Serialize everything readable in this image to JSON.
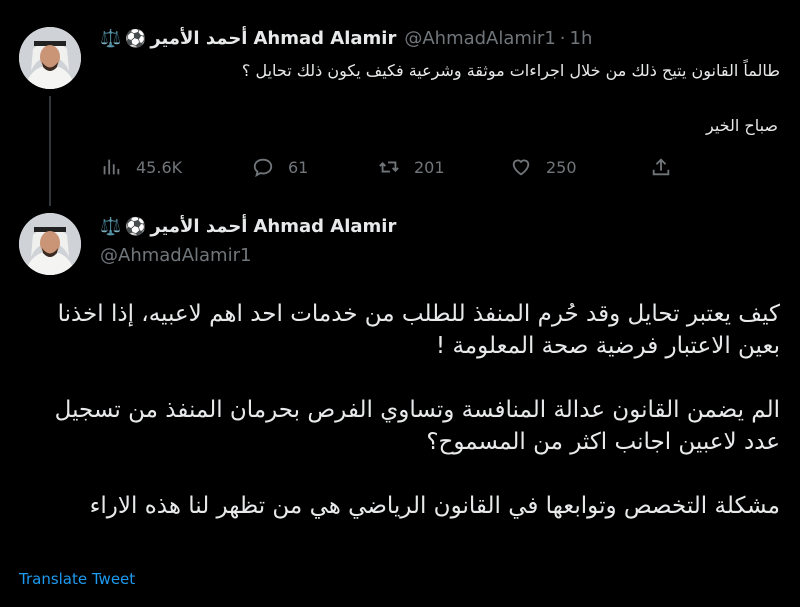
{
  "tweet1": {
    "display_name": "Ahmad Alamir",
    "arabic_name": "أحمد الأمير",
    "emoji_ball": "⚽",
    "emoji_scale": "⚖️",
    "handle": "@AhmadAlamir1",
    "separator": "·",
    "time": "1h",
    "text_line1": "طالماً القانون يتيح ذلك من خلال اجراءات موثقة وشرعية فكيف يكون ذلك تحايل ؟",
    "text_line2": "صباح الخير",
    "stats": {
      "views": "45.6K",
      "replies": "61",
      "retweets": "201",
      "likes": "250"
    }
  },
  "tweet2": {
    "display_name": "Ahmad Alamir",
    "arabic_name": "أحمد الأمير",
    "emoji_ball": "⚽",
    "emoji_scale": "⚖️",
    "handle": "@AhmadAlamir1",
    "para1_line1": "كيف يعتبر تحايل وقد حُرم المنفذ للطلب من خدمات احد اهم لاعبيه، إذا اخذنا",
    "para1_line2": "بعين الاعتبار فرضية صحة المعلومة !",
    "para2_line1": "الم يضمن القانون عدالة المنافسة وتساوي الفرص بحرمان المنفذ من تسجيل",
    "para2_line2": "عدد لاعبين اجانب اكثر من المسموح؟",
    "para3_line1": "مشكلة التخصص وتوابعها في القانون الرياضي هي من تظهر لنا هذه الاراء",
    "translate_label": "Translate Tweet"
  },
  "colors": {
    "background": "#000000",
    "text": "#e7e9ea",
    "muted": "#71767b",
    "link": "#1d9bf0"
  }
}
